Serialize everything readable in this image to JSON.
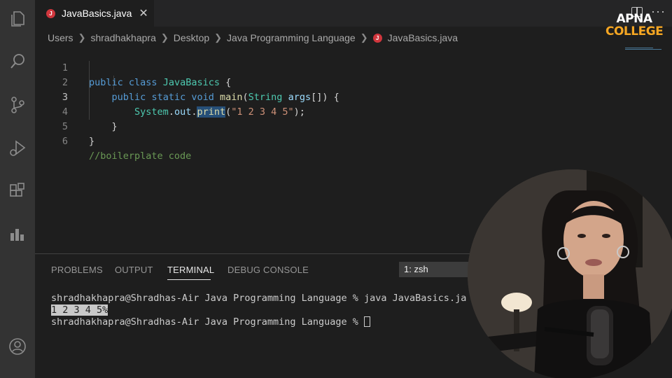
{
  "activity_bar": {
    "icons": [
      "files-icon",
      "search-icon",
      "source-control-icon",
      "run-debug-icon",
      "extensions-icon",
      "chart-icon",
      "account-icon"
    ]
  },
  "tab": {
    "label": "JavaBasics.java",
    "close": "✕",
    "file_badge": "J"
  },
  "breadcrumb": [
    "Users",
    "shradhakhapra",
    "Desktop",
    "Java Programming Language",
    "JavaBasics.java"
  ],
  "logo": {
    "top": "APNA",
    "bottom": "COLLEGE"
  },
  "editor": {
    "line_numbers": [
      "1",
      "2",
      "3",
      "4",
      "5",
      "6"
    ],
    "lines": {
      "l1": {
        "kw1": "public",
        "kw2": "class",
        "cls": "JavaBasics",
        "brace": "{"
      },
      "l2": {
        "kw1": "public",
        "kw2": "static",
        "kw3": "void",
        "fn": "main",
        "paren_open": "(",
        "type": "String",
        "param": "args",
        "rest": "[]) {"
      },
      "l3": {
        "obj": "System",
        "dot1": ".",
        "field": "out",
        "dot2": ".",
        "method": "print",
        "paren_open": "(",
        "str": "\"1 2 3 4 5\"",
        "rest": ");"
      },
      "l4": {
        "brace": "}"
      },
      "l5": {
        "brace": "}"
      },
      "l6": {
        "comment": "//boilerplate code"
      }
    }
  },
  "panel": {
    "tabs": [
      "PROBLEMS",
      "OUTPUT",
      "TERMINAL",
      "DEBUG CONSOLE"
    ],
    "active_tab": "TERMINAL",
    "terminal_select": "1: zsh",
    "terminal_lines": {
      "cmd": "shradhakhapra@Shradhas-Air Java Programming Language % java JavaBasics.ja",
      "output": "1 2 3 4 5",
      "eol_marker": "%",
      "prompt": "shradhakhapra@Shradhas-Air Java Programming Language % "
    }
  },
  "colors": {
    "activity_bar": "#333333",
    "editor_bg": "#1e1e1e",
    "keyword": "#569cd6",
    "class": "#4ec9b0",
    "function": "#dcdcaa",
    "string": "#ce9178",
    "comment": "#6a9955",
    "logo_accent": "#f5a623"
  }
}
